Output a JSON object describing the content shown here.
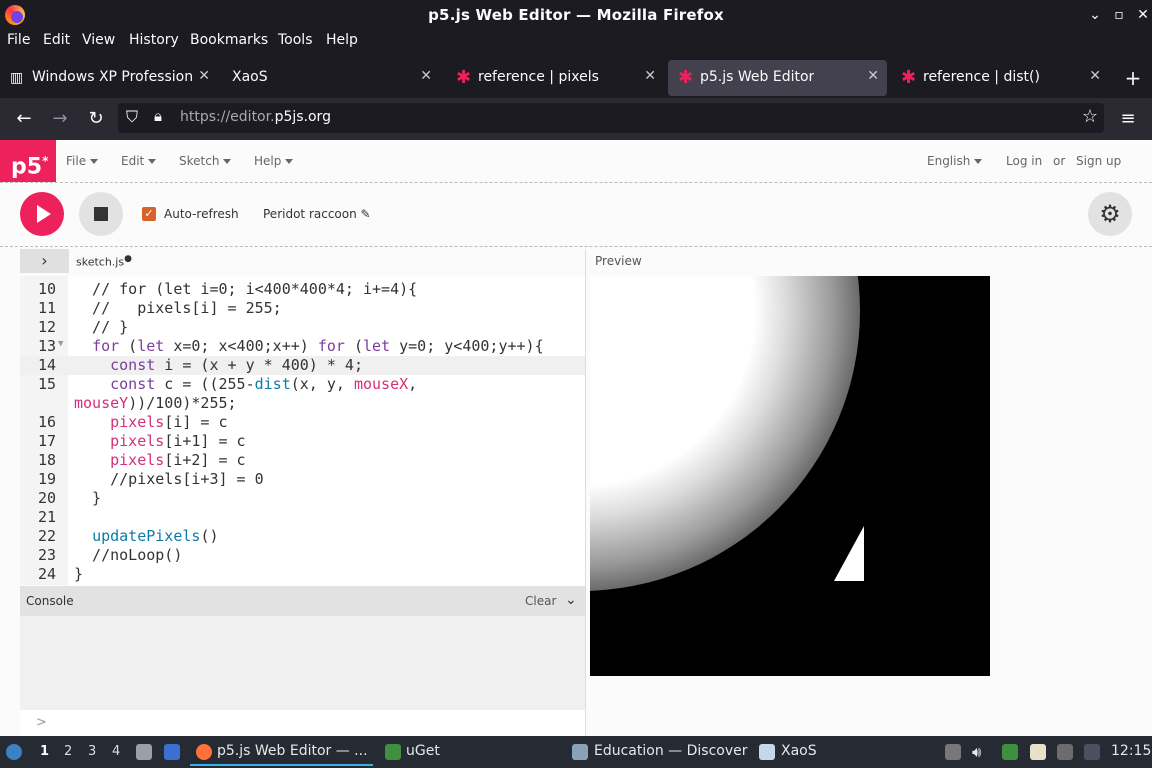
{
  "window": {
    "title": "p5.js Web Editor — Mozilla Firefox"
  },
  "menubar": [
    "File",
    "Edit",
    "View",
    "History",
    "Bookmarks",
    "Tools",
    "Help"
  ],
  "tabs": [
    {
      "label": "Windows XP Professional",
      "active": false,
      "icon": "window-icon"
    },
    {
      "label": "XaoS",
      "active": false,
      "icon": "none"
    },
    {
      "label": "reference | pixels",
      "active": false,
      "icon": "p5-star-icon"
    },
    {
      "label": "p5.js Web Editor",
      "active": true,
      "icon": "p5-star-icon"
    },
    {
      "label": "reference | dist()",
      "active": false,
      "icon": "p5-star-icon"
    }
  ],
  "nav": {
    "url_prefix": "https://editor.",
    "url_domain": "p5js.org"
  },
  "p5": {
    "logo": "p5",
    "menus": [
      "File",
      "Edit",
      "Sketch",
      "Help"
    ],
    "language": "English",
    "login": "Log in",
    "or": "or",
    "signup": "Sign up",
    "auto_refresh": "Auto-refresh",
    "sketch_name": "Peridot raccoon",
    "file_name": "sketch.js",
    "preview_label": "Preview",
    "console_label": "Console",
    "clear_label": "Clear",
    "console_prompt": ">"
  },
  "code_lines": [
    {
      "n": "10",
      "text": "  // for (let i=0; i<400*400*4; i+=4){"
    },
    {
      "n": "11",
      "text": "  //   pixels[i] = 255;"
    },
    {
      "n": "12",
      "text": "  // }"
    },
    {
      "n": "13",
      "text": "  for (let x=0; x<400;x++) for (let y=0; y<400;y++){"
    },
    {
      "n": "14",
      "text": "    const i = (x + y * 400) * 4;"
    },
    {
      "n": "15",
      "text": "    const c = ((255-dist(x, y, mouseX,"
    },
    {
      "n": "",
      "text": "mouseY))/100)*255;"
    },
    {
      "n": "16",
      "text": "    pixels[i] = c"
    },
    {
      "n": "17",
      "text": "    pixels[i+1] = c"
    },
    {
      "n": "18",
      "text": "    pixels[i+2] = c"
    },
    {
      "n": "19",
      "text": "    //pixels[i+3] = 0"
    },
    {
      "n": "20",
      "text": "  }"
    },
    {
      "n": "21",
      "text": ""
    },
    {
      "n": "22",
      "text": "  updatePixels()"
    },
    {
      "n": "23",
      "text": "  //noLoop()"
    },
    {
      "n": "24",
      "text": "}"
    }
  ],
  "taskbar": {
    "workspaces": [
      "1",
      "2",
      "3",
      "4"
    ],
    "tasks": [
      "p5.js Web Editor — ...",
      "uGet",
      "Education — Discover",
      "XaoS"
    ],
    "clock": "12:15"
  },
  "colors": {
    "p5_pink": "#ed225d",
    "checkbox": "#d9622b"
  }
}
